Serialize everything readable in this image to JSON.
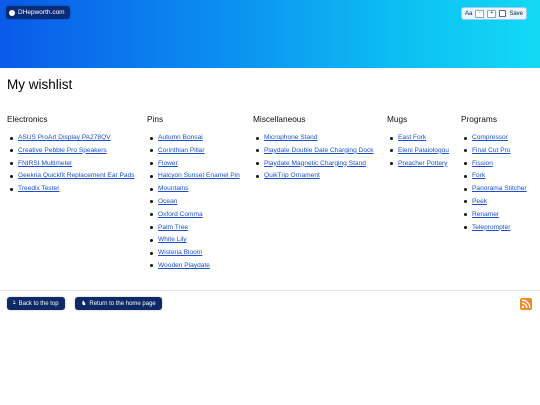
{
  "site": {
    "label": "DHepworth.com"
  },
  "controls": {
    "font_label": "Aa",
    "minus": "-",
    "plus": "+",
    "save_label": "Save"
  },
  "page": {
    "title": "My wishlist"
  },
  "columns": [
    {
      "heading": "Electronics",
      "items": [
        "ASUS ProArt Display PA278QV",
        "Creative Pebble Pro Speakers",
        "FNIRSI Multimeter",
        "Geekria Quickfit Replacement Ear Pads",
        "Treedix Tester"
      ]
    },
    {
      "heading": "Pins",
      "items": [
        "Autumn Bonsai",
        "Corinthian Pillar",
        "Flower",
        "Halcyon Sunset Enamel Pin",
        "Mountains",
        "Ocean",
        "Oxford Comma",
        "Palm Tree",
        "White Lily",
        "Wisteria Bloom",
        "Wooden Playdate"
      ]
    },
    {
      "heading": "Miscellaneous",
      "items": [
        "Microphone Stand",
        "Playdate Double Date Charging Dock",
        "Playdate Magnetic Charging Stand",
        "QuikTrip Ornament"
      ]
    },
    {
      "heading": "Mugs",
      "items": [
        "East Fork",
        "Eleni Palaiologou",
        "Preacher Pottery"
      ]
    },
    {
      "heading": "Programs",
      "items": [
        "Compressor",
        "Final Cut Pro",
        "Fission",
        "Fork",
        "Panorama Stitcher",
        "Peek",
        "Renamer",
        "Teleprompter"
      ]
    }
  ],
  "footer": {
    "back_to_top": "Back to the top",
    "home": "Return to the home page"
  },
  "icons": {
    "back_to_top": "hand-pointing-up-icon",
    "home": "horse-icon",
    "rss": "rss-icon"
  },
  "colors": {
    "header_start": "#0a5ae8",
    "header_end": "#14d9f4",
    "link": "#1a4fd0",
    "button": "#0e2a66",
    "rss": "#f08a24"
  }
}
